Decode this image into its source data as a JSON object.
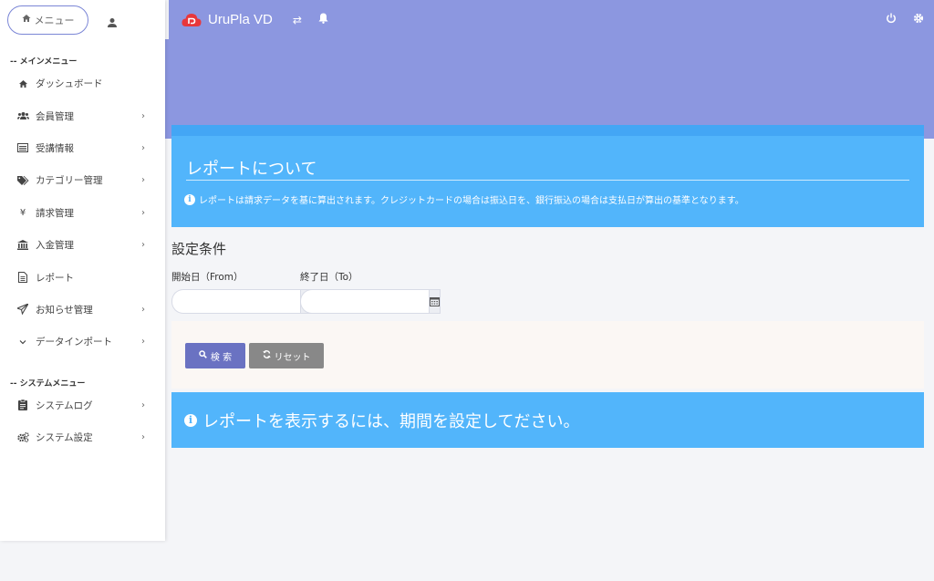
{
  "sidebar": {
    "menu_label": "メニュー",
    "main_section": "-- メインメニュー",
    "system_section": "-- システムメニュー",
    "main_items": [
      {
        "label": "ダッシュボード",
        "icon": "home-icon",
        "has_submenu": false
      },
      {
        "label": "会員管理",
        "icon": "users-icon",
        "has_submenu": true
      },
      {
        "label": "受講情報",
        "icon": "list-icon",
        "has_submenu": true
      },
      {
        "label": "カテゴリー管理",
        "icon": "tags-icon",
        "has_submenu": true
      },
      {
        "label": "請求管理",
        "icon": "yen-icon",
        "has_submenu": true
      },
      {
        "label": "入金管理",
        "icon": "bank-icon",
        "has_submenu": true
      },
      {
        "label": "レポート",
        "icon": "document-icon",
        "has_submenu": false
      },
      {
        "label": "お知らせ管理",
        "icon": "send-icon",
        "has_submenu": true
      },
      {
        "label": "データインポート",
        "icon": "chevron-down-icon",
        "has_submenu": true
      }
    ],
    "system_items": [
      {
        "label": "システムログ",
        "icon": "clipboard-icon",
        "has_submenu": true
      },
      {
        "label": "システム設定",
        "icon": "cogs-icon",
        "has_submenu": true
      }
    ]
  },
  "topbar": {
    "brand": "UruPla VD"
  },
  "info": {
    "title": "レポートについて",
    "text": "レポートは請求データを基に算出されます。クレジットカードの場合は振込日を、銀行振込の場合は支払日が算出の基準となります。"
  },
  "form": {
    "section_title": "設定条件",
    "from_label": "開始日（From）",
    "to_label": "終了日（To）",
    "from_value": "",
    "to_value": "",
    "search_label": "検 索",
    "reset_label": "リセット"
  },
  "notice": {
    "text": "レポートを表示するには、期間を設定してださい。"
  },
  "colors": {
    "header": "#8c97e0",
    "info": "#52b5fb",
    "primary_button": "#6a72c2",
    "secondary_button": "#888888"
  }
}
